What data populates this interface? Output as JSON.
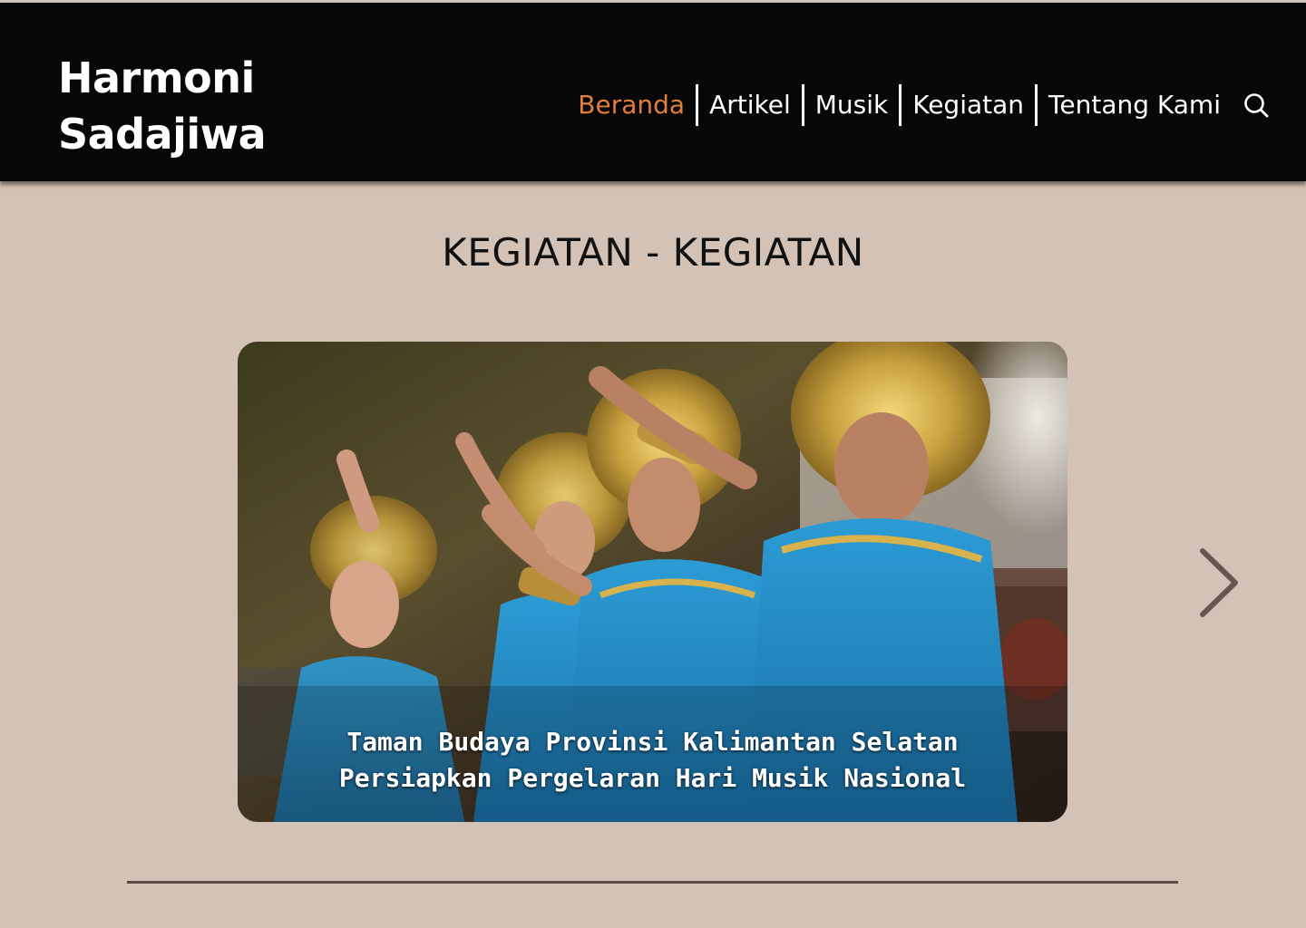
{
  "header": {
    "logo_line1": "Harmoni",
    "logo_line2": "Sadajiwa",
    "nav": [
      {
        "label": "Beranda",
        "active": true
      },
      {
        "label": "Artikel",
        "active": false
      },
      {
        "label": "Musik",
        "active": false
      },
      {
        "label": "Kegiatan",
        "active": false
      },
      {
        "label": "Tentang Kami",
        "active": false
      }
    ],
    "search_icon": "search-icon"
  },
  "main": {
    "title": "KEGIATAN - KEGIATAN",
    "carousel": {
      "caption_line1": "Taman Budaya Provinsi Kalimantan Selatan",
      "caption_line2": "Persiapkan Pergelaran Hari Musik Nasional",
      "next_icon": "chevron-right-icon"
    }
  },
  "colors": {
    "background": "#d3c2b6",
    "header": "#070707",
    "nav_active": "#e27e3b",
    "divider": "#5c4a41",
    "arrow": "#6b5450"
  }
}
